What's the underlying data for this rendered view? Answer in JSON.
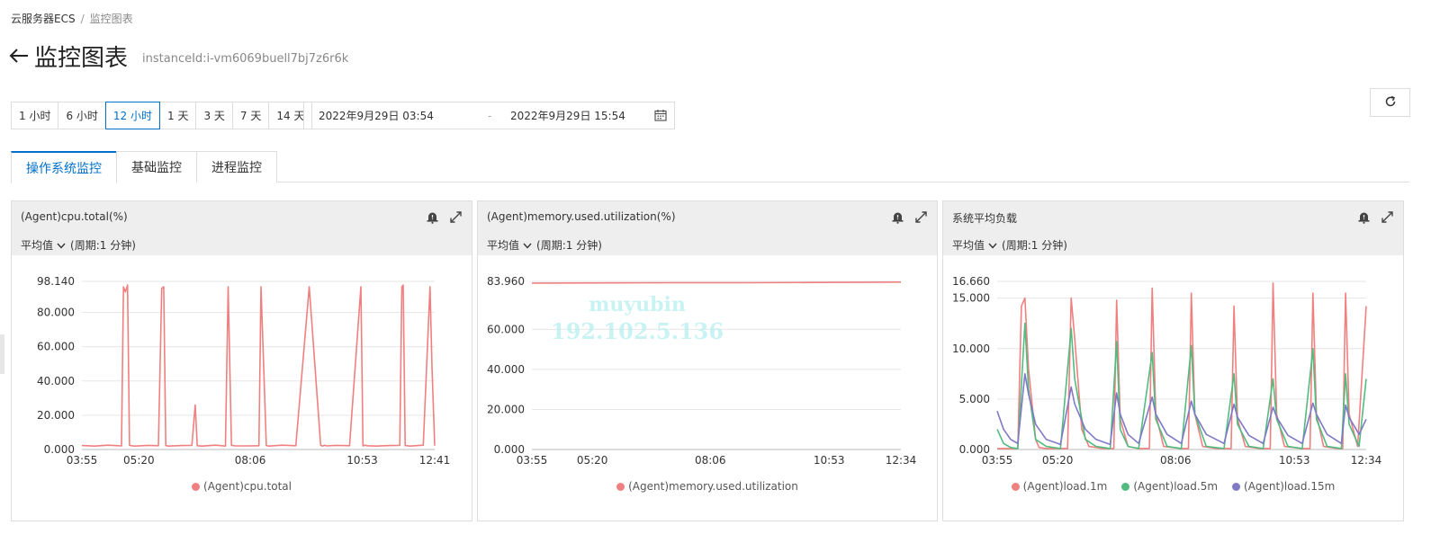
{
  "breadcrumb": {
    "root": "云服务器ECS",
    "sep": "/",
    "current": "监控图表"
  },
  "header": {
    "title": "监控图表",
    "instance": "instanceId:i-vm6069buell7bj7z6r6k"
  },
  "time_ranges": [
    "1 小时",
    "6 小时",
    "12 小时",
    "1 天",
    "3 天",
    "7 天",
    "14 天"
  ],
  "time_range_selected": "12 小时",
  "date_range": {
    "start": "2022年9月29日 03:54",
    "dash": "-",
    "end": "2022年9月29日 15:54"
  },
  "tabs": [
    "操作系统监控",
    "基础监控",
    "进程监控"
  ],
  "active_tab": "操作系统监控",
  "watermark": {
    "line1": "muyubin",
    "line2": "192.102.5.136"
  },
  "icons": {
    "refresh": "refresh-icon",
    "calendar": "calendar-icon",
    "bell": "alarm-bell-icon",
    "expand": "expand-icon",
    "back": "back-arrow-icon"
  },
  "panels": [
    {
      "title": "(Agent)cpu.total(%)",
      "aggregation": "平均值",
      "period": "(周期:1 分钟)",
      "legend": [
        {
          "name": "(Agent)cpu.total",
          "color": "#f08080"
        }
      ]
    },
    {
      "title": "(Agent)memory.used.utilization(%)",
      "aggregation": "平均值",
      "period": "(周期:1 分钟)",
      "legend": [
        {
          "name": "(Agent)memory.used.utilization",
          "color": "#f08080"
        }
      ]
    },
    {
      "title": "系统平均负载",
      "aggregation": "平均值",
      "period": "(周期:1 分钟)",
      "legend": [
        {
          "name": "(Agent)load.1m",
          "color": "#f08080"
        },
        {
          "name": "(Agent)load.5m",
          "color": "#52bb7f"
        },
        {
          "name": "(Agent)load.15m",
          "color": "#7f79c6"
        }
      ]
    }
  ],
  "chart_data": [
    {
      "type": "line",
      "ylim": [
        0,
        98.14
      ],
      "yticks": [
        "98.140",
        "80.000",
        "60.000",
        "40.000",
        "20.000",
        "0.000"
      ],
      "ytick_values": [
        98.14,
        80,
        60,
        40,
        20,
        0
      ],
      "xticks": [
        "03:55",
        "05:20",
        "08:06",
        "10:53",
        "12:41"
      ],
      "xtick_minutes": [
        1,
        86,
        252,
        419,
        527
      ],
      "grid": true,
      "x_domain": [
        1,
        527
      ],
      "series": [
        {
          "name": "(Agent)cpu.total",
          "color": "#f08080",
          "x": [
            1,
            20,
            40,
            60,
            63,
            66,
            69,
            72,
            75,
            80,
            100,
            115,
            120,
            123,
            126,
            130,
            150,
            165,
            170,
            173,
            180,
            200,
            215,
            219,
            224,
            230,
            250,
            265,
            268,
            272,
            276,
            280,
            300,
            320,
            340,
            357,
            360,
            363,
            366,
            380,
            400,
            417,
            420,
            423,
            426,
            440,
            460,
            475,
            478,
            480,
            483,
            490,
            510,
            520,
            523,
            527
          ],
          "y": [
            2.3,
            2.0,
            2.5,
            2.1,
            95,
            92,
            96,
            2.5,
            2.2,
            2.0,
            2.4,
            2.2,
            94,
            95,
            2.3,
            2.0,
            2.3,
            2.4,
            26,
            2.2,
            2.0,
            2.5,
            2.0,
            95,
            2.4,
            2.1,
            2.1,
            2.2,
            95,
            48,
            2.3,
            2.0,
            2.5,
            2.2,
            95,
            2.4,
            2.0,
            2.5,
            2.1,
            2.4,
            2.2,
            95,
            2.1,
            2.5,
            2.2,
            2.0,
            2.3,
            2.4,
            95,
            96,
            2.3,
            2.0,
            2.5,
            95,
            48,
            2.2
          ]
        }
      ]
    },
    {
      "type": "line",
      "ylim": [
        0,
        83.96
      ],
      "yticks": [
        "83.960",
        "60.000",
        "40.000",
        "20.000",
        "0.000"
      ],
      "ytick_values": [
        83.96,
        60,
        40,
        20,
        0
      ],
      "xticks": [
        "03:55",
        "05:20",
        "08:06",
        "10:53",
        "12:34"
      ],
      "xtick_minutes": [
        1,
        86,
        252,
        419,
        520
      ],
      "grid": true,
      "x_domain": [
        1,
        520
      ],
      "series": [
        {
          "name": "(Agent)memory.used.utilization",
          "color": "#f08080",
          "x": [
            1,
            100,
            200,
            300,
            400,
            520
          ],
          "y": [
            83.1,
            83.2,
            83.3,
            83.3,
            83.4,
            83.6
          ]
        }
      ]
    },
    {
      "type": "line",
      "ylim": [
        0,
        16.66
      ],
      "yticks": [
        "16.660",
        "15.000",
        "10.000",
        "5.000",
        "0.000"
      ],
      "ytick_values": [
        16.66,
        15,
        10,
        5,
        0
      ],
      "xticks": [
        "03:55",
        "05:20",
        "08:06",
        "10:53",
        "12:34"
      ],
      "xtick_minutes": [
        1,
        86,
        252,
        419,
        520
      ],
      "grid": true,
      "x_domain": [
        1,
        520
      ],
      "series": [
        {
          "name": "(Agent)load.1m",
          "color": "#f08080",
          "x": [
            1,
            30,
            35,
            40,
            45,
            55,
            60,
            70,
            100,
            105,
            110,
            120,
            130,
            150,
            165,
            169,
            174,
            185,
            200,
            215,
            219,
            224,
            235,
            260,
            270,
            274,
            279,
            290,
            310,
            330,
            334,
            339,
            350,
            370,
            385,
            389,
            394,
            405,
            430,
            441,
            445,
            450,
            460,
            480,
            487,
            491,
            496,
            508,
            520
          ],
          "y": [
            0.1,
            0.1,
            14.2,
            15.0,
            8.0,
            1.0,
            0.2,
            0.1,
            0.1,
            15.0,
            11.0,
            2.0,
            0.3,
            0.1,
            0.1,
            14.8,
            3.0,
            0.3,
            0.1,
            0.1,
            16.0,
            3.5,
            0.3,
            0.1,
            0.1,
            15.5,
            3.5,
            0.3,
            0.1,
            0.1,
            14.2,
            3.0,
            0.3,
            0.1,
            0.1,
            16.5,
            3.5,
            0.3,
            0.1,
            0.1,
            15.5,
            3.5,
            0.3,
            0.1,
            0.1,
            15.5,
            3.5,
            0.3,
            14.2
          ]
        },
        {
          "name": "(Agent)load.5m",
          "color": "#52bb7f",
          "x": [
            1,
            10,
            20,
            30,
            40,
            45,
            55,
            70,
            90,
            105,
            110,
            125,
            140,
            160,
            169,
            174,
            185,
            200,
            219,
            224,
            240,
            260,
            274,
            279,
            295,
            320,
            334,
            339,
            355,
            375,
            389,
            394,
            410,
            430,
            445,
            450,
            465,
            485,
            491,
            496,
            510,
            520
          ],
          "y": [
            2.0,
            0.6,
            0.2,
            0.1,
            12.5,
            6.0,
            1.0,
            0.3,
            0.1,
            12.0,
            7.0,
            1.0,
            0.3,
            0.1,
            10.7,
            2.0,
            0.3,
            0.1,
            9.6,
            3.0,
            0.3,
            0.1,
            10.3,
            3.5,
            0.3,
            0.1,
            7.5,
            2.5,
            0.3,
            0.1,
            7.0,
            3.0,
            0.3,
            0.1,
            10.0,
            3.0,
            0.3,
            0.1,
            7.5,
            2.5,
            0.3,
            7.0
          ]
        },
        {
          "name": "(Agent)load.15m",
          "color": "#7f79c6",
          "x": [
            1,
            10,
            20,
            30,
            40,
            45,
            55,
            70,
            90,
            105,
            110,
            125,
            140,
            160,
            169,
            174,
            185,
            200,
            219,
            224,
            240,
            260,
            274,
            279,
            295,
            320,
            334,
            339,
            355,
            375,
            389,
            394,
            410,
            430,
            445,
            450,
            465,
            485,
            491,
            496,
            510,
            520
          ],
          "y": [
            3.8,
            2.0,
            1.0,
            0.6,
            7.5,
            5.5,
            2.5,
            1.0,
            0.5,
            6.2,
            4.5,
            2.0,
            1.0,
            0.5,
            5.6,
            3.5,
            1.5,
            0.6,
            5.2,
            3.5,
            1.5,
            0.6,
            4.8,
            3.5,
            1.5,
            0.6,
            4.5,
            3.2,
            1.4,
            0.6,
            4.2,
            3.2,
            1.4,
            0.6,
            4.6,
            3.5,
            1.5,
            0.6,
            4.4,
            3.2,
            1.5,
            3.0
          ]
        }
      ]
    }
  ]
}
